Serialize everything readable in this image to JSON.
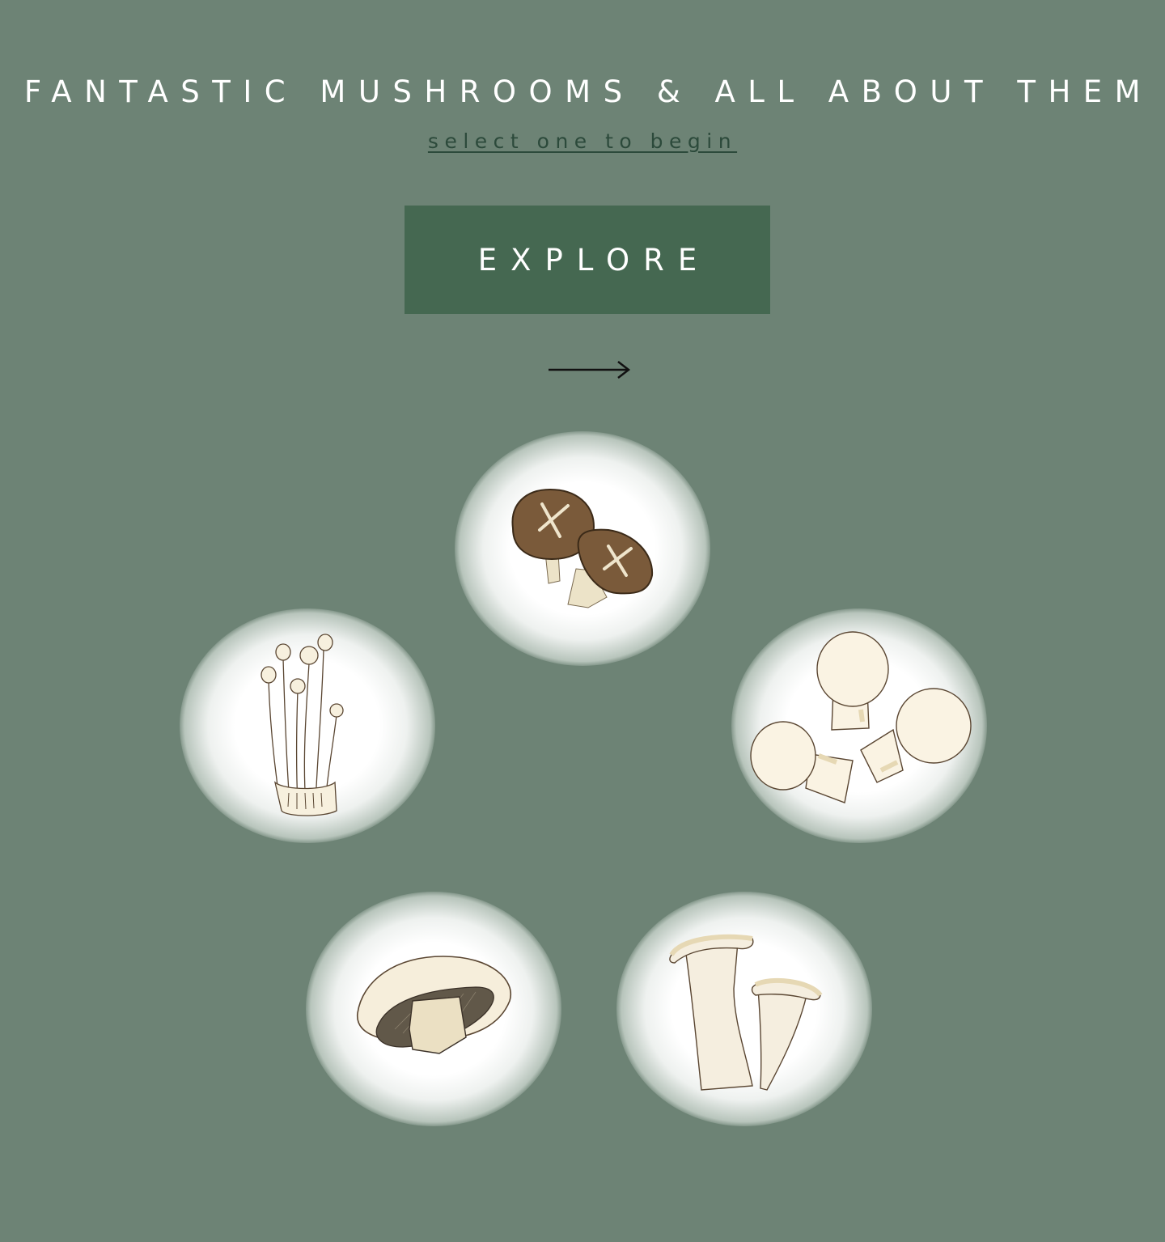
{
  "header": {
    "title": "FANTASTIC MUSHROOMS & ALL ABOUT THEM",
    "subtitle": "select one to begin"
  },
  "cta": {
    "explore_label": "EXPLORE",
    "arrow_icon": "arrow-right-icon"
  },
  "mushrooms": [
    {
      "id": "shiitake",
      "icon": "shiitake-mushroom-icon"
    },
    {
      "id": "enoki",
      "icon": "enoki-mushroom-icon"
    },
    {
      "id": "button",
      "icon": "button-mushroom-icon"
    },
    {
      "id": "portobello",
      "icon": "portobello-mushroom-icon"
    },
    {
      "id": "king-oyster",
      "icon": "king-oyster-mushroom-icon"
    }
  ],
  "colors": {
    "background": "#6d8375",
    "button": "#456851",
    "subtitle": "#2c4a3b"
  }
}
